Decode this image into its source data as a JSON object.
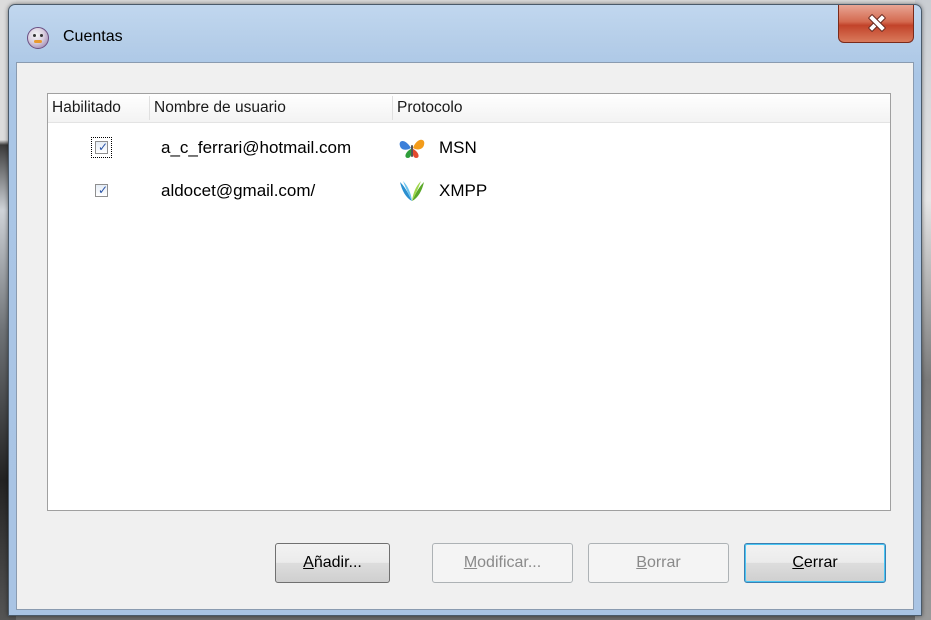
{
  "window": {
    "title": "Cuentas",
    "close_label": "Close"
  },
  "accounts_list": {
    "columns": [
      "Habilitado",
      "Nombre de usuario",
      "Protocolo"
    ],
    "rows": [
      {
        "enabled": true,
        "username": "a_c_ferrari@hotmail.com",
        "protocol": "MSN",
        "icon": "msn-butterfly-icon"
      },
      {
        "enabled": true,
        "username": "aldocet@gmail.com/",
        "protocol": "XMPP",
        "icon": "xmpp-icon"
      }
    ]
  },
  "buttons": {
    "add": {
      "first": "A",
      "rest": "ñadir..."
    },
    "modify": {
      "first": "M",
      "rest": "odificar..."
    },
    "delete": {
      "first": "B",
      "rest": "orrar"
    },
    "close": {
      "first": "C",
      "rest": "errar"
    }
  },
  "colors": {
    "title_bar": "#b4cde8",
    "close_button": "#c2432a",
    "client_background": "#f0f0f0",
    "checkbox_mark": "#2b54a7"
  }
}
